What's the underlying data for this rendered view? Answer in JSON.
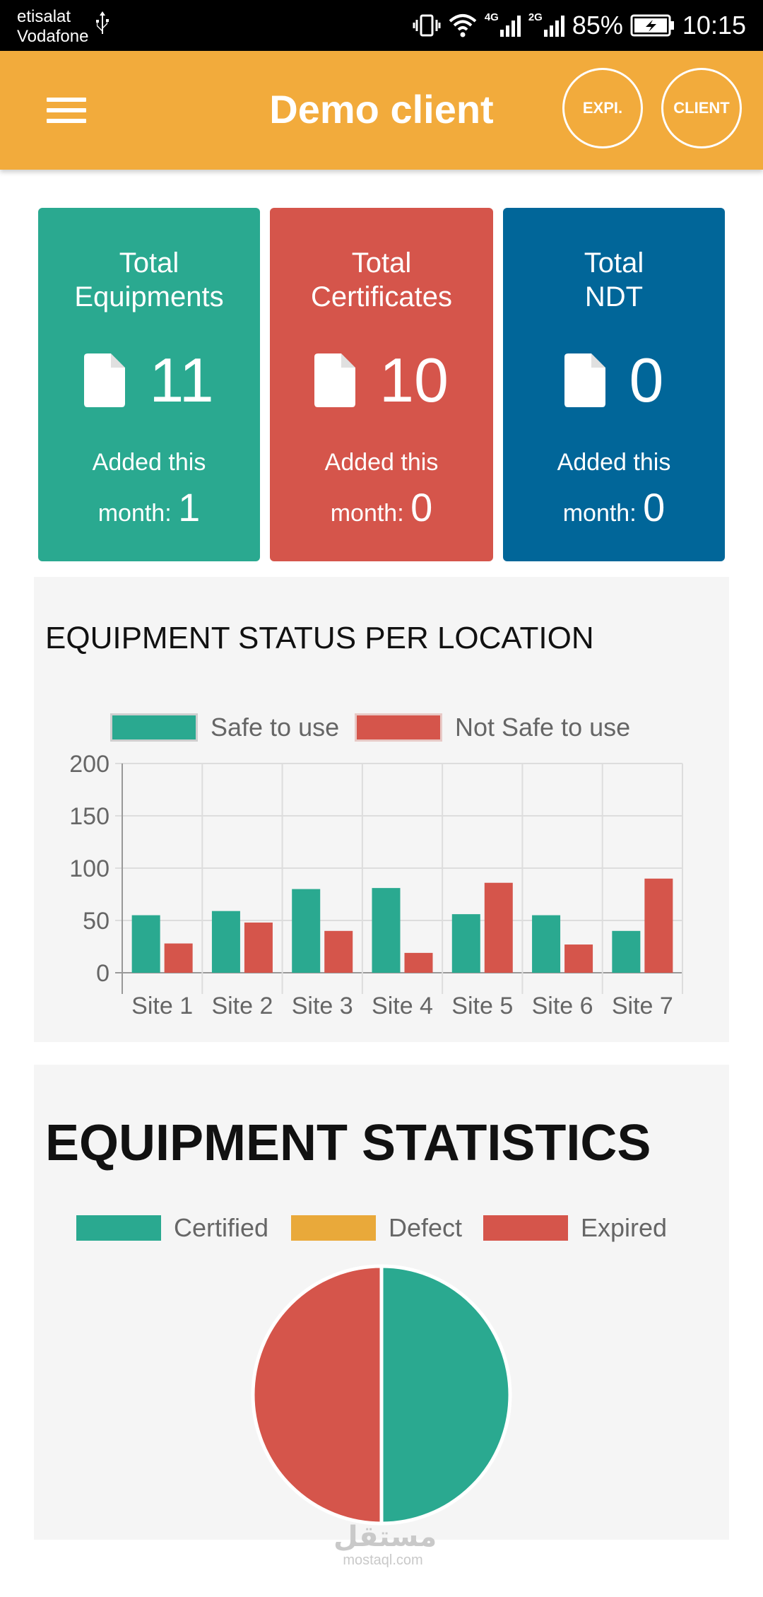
{
  "status_bar": {
    "carrier_line1": "etisalat",
    "carrier_line2": "Vodafone",
    "network_4g": "4G",
    "network_2g": "2G",
    "battery": "85%",
    "time": "10:15"
  },
  "app_bar": {
    "title": "Demo client",
    "expi_label": "EXPI.",
    "client_label": "CLIENT",
    "color": "#f2ab3c"
  },
  "cards": [
    {
      "title_line1": "Total",
      "title_line2": "Equipments",
      "count": "11",
      "added_line1": "Added this",
      "added_line2": "month:",
      "added_value": "1",
      "color": "#2aa990"
    },
    {
      "title_line1": "Total",
      "title_line2": "Certificates",
      "count": "10",
      "added_line1": "Added this",
      "added_line2": "month:",
      "added_value": "0",
      "color": "#d5554b"
    },
    {
      "title_line1": "Total",
      "title_line2": "NDT",
      "count": "0",
      "added_line1": "Added this",
      "added_line2": "month:",
      "added_value": "0",
      "color": "#016699"
    }
  ],
  "chart_data": [
    {
      "type": "bar",
      "title": "EQUIPMENT STATUS PER LOCATION",
      "categories": [
        "Site 1",
        "Site 2",
        "Site 3",
        "Site 4",
        "Site 5",
        "Site 6",
        "Site 7"
      ],
      "series": [
        {
          "name": "Safe to use",
          "color": "#2aa990",
          "values": [
            55,
            59,
            80,
            81,
            56,
            55,
            40
          ]
        },
        {
          "name": "Not Safe to use",
          "color": "#d5554b",
          "values": [
            28,
            48,
            40,
            19,
            86,
            27,
            90
          ]
        }
      ],
      "ylim": [
        0,
        200
      ],
      "yticks": [
        "200",
        "150",
        "100",
        "50",
        "0"
      ],
      "grid": true,
      "legend": "top"
    },
    {
      "type": "pie",
      "title": "EQUIPMENT STATISTICS",
      "categories": [
        "Certified",
        "Defect",
        "Expired"
      ],
      "values": [
        50,
        0,
        50
      ],
      "colors": [
        "#2aa990",
        "#e9a93a",
        "#d5554b"
      ],
      "legend": "top"
    }
  ],
  "watermark": {
    "line1": "مستقل",
    "line2": "mostaql.com"
  }
}
